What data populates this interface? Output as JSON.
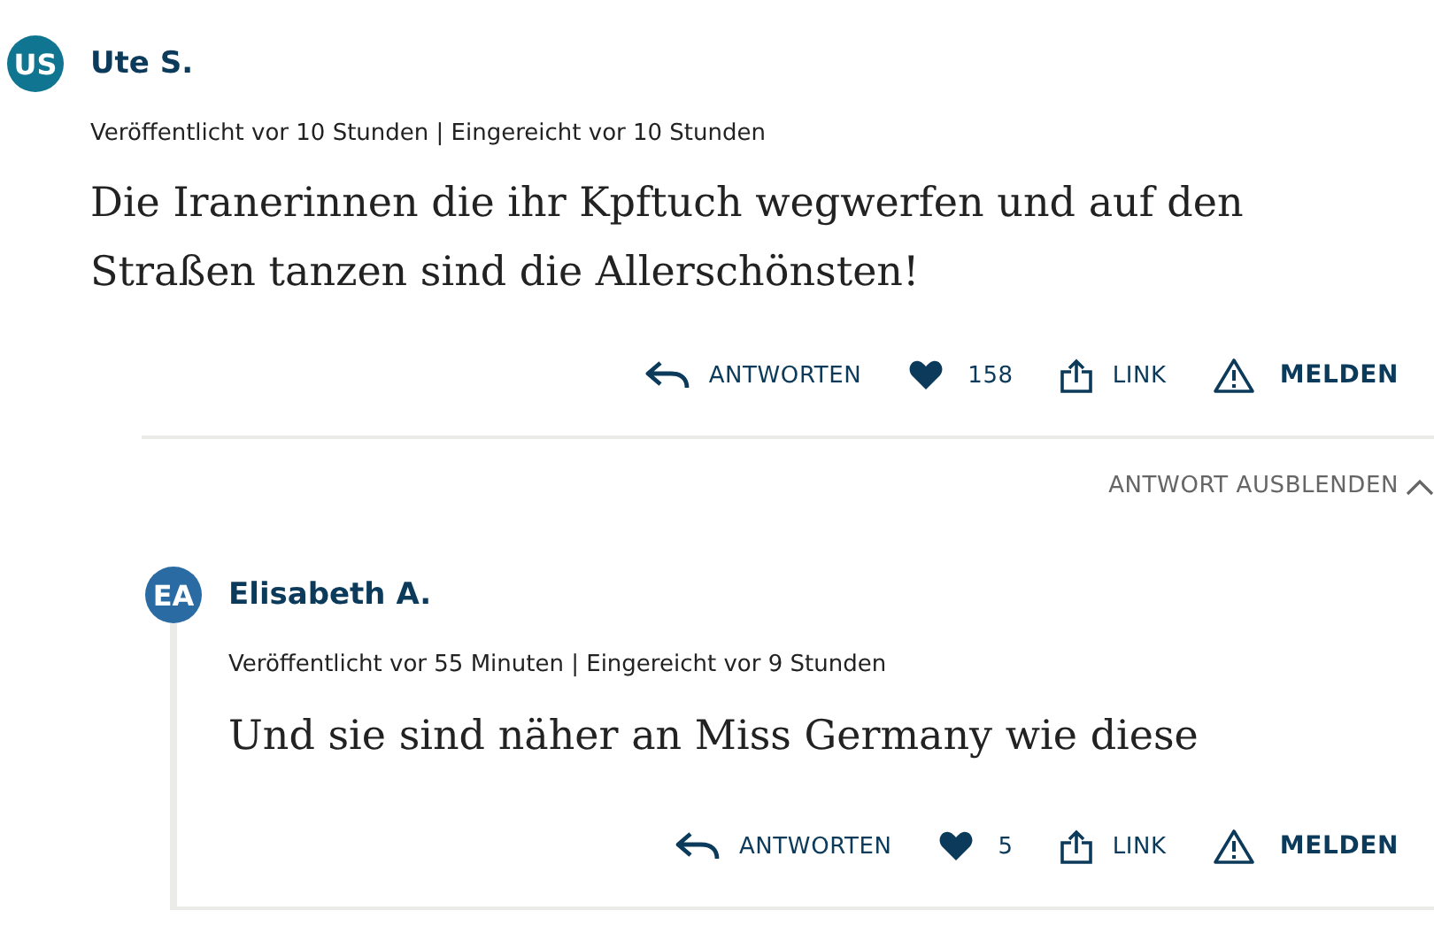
{
  "comment": {
    "initials": "US",
    "color": "#0f7590",
    "author": "Ute S.",
    "meta": "Veröffentlicht vor 10 Stunden | Eingereicht vor 10 Stunden",
    "text": "Die Iranerinnen die ihr Kpftuch wegwerfen und auf den Straßen tanzen sind die Allerschönsten!",
    "actions": {
      "reply": "ANTWORTEN",
      "likes": "158",
      "link": "LINK",
      "report": "MELDEN"
    }
  },
  "toggle_replies": "ANTWORT AUSBLENDEN",
  "reply": {
    "initials": "EA",
    "color": "#2a6ba3",
    "author": "Elisabeth A.",
    "meta": "Veröffentlicht vor 55 Minuten | Eingereicht vor 9 Stunden",
    "text": "Und sie sind näher an Miss Germany wie diese",
    "actions": {
      "reply": "ANTWORTEN",
      "likes": "5",
      "link": "LINK",
      "report": "MELDEN"
    }
  }
}
